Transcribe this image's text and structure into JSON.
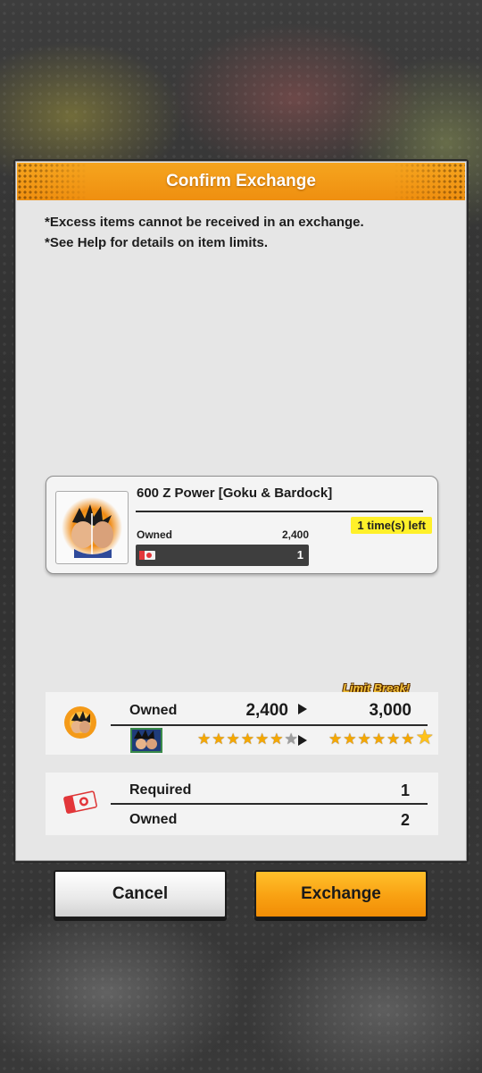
{
  "dialog": {
    "title": "Confirm Exchange",
    "notes": [
      "*Excess items cannot be received in an exchange.",
      "*See Help for details on item limits."
    ]
  },
  "item": {
    "name": "600 Z Power [Goku & Bardock]",
    "times_left": "1 time(s) left",
    "owned_label": "Owned",
    "owned_value": "2,400",
    "cost_value": "1",
    "thumbnail_icon": "goku-bardock-portrait-icon"
  },
  "limit_break": {
    "tag": "Limit Break!",
    "owned_label": "Owned",
    "from_value": "2,400",
    "to_value": "3,000",
    "stars_before": {
      "filled": 6,
      "empty": 1
    },
    "stars_after": {
      "filled": 7,
      "highlight_last": true
    }
  },
  "requirement": {
    "required_label": "Required",
    "required_value": "1",
    "owned_label": "Owned",
    "owned_value": "2"
  },
  "buttons": {
    "cancel": "Cancel",
    "exchange": "Exchange"
  },
  "colors": {
    "accent": "#f39a16",
    "badge": "#fff02a",
    "star": "#f5a800"
  }
}
